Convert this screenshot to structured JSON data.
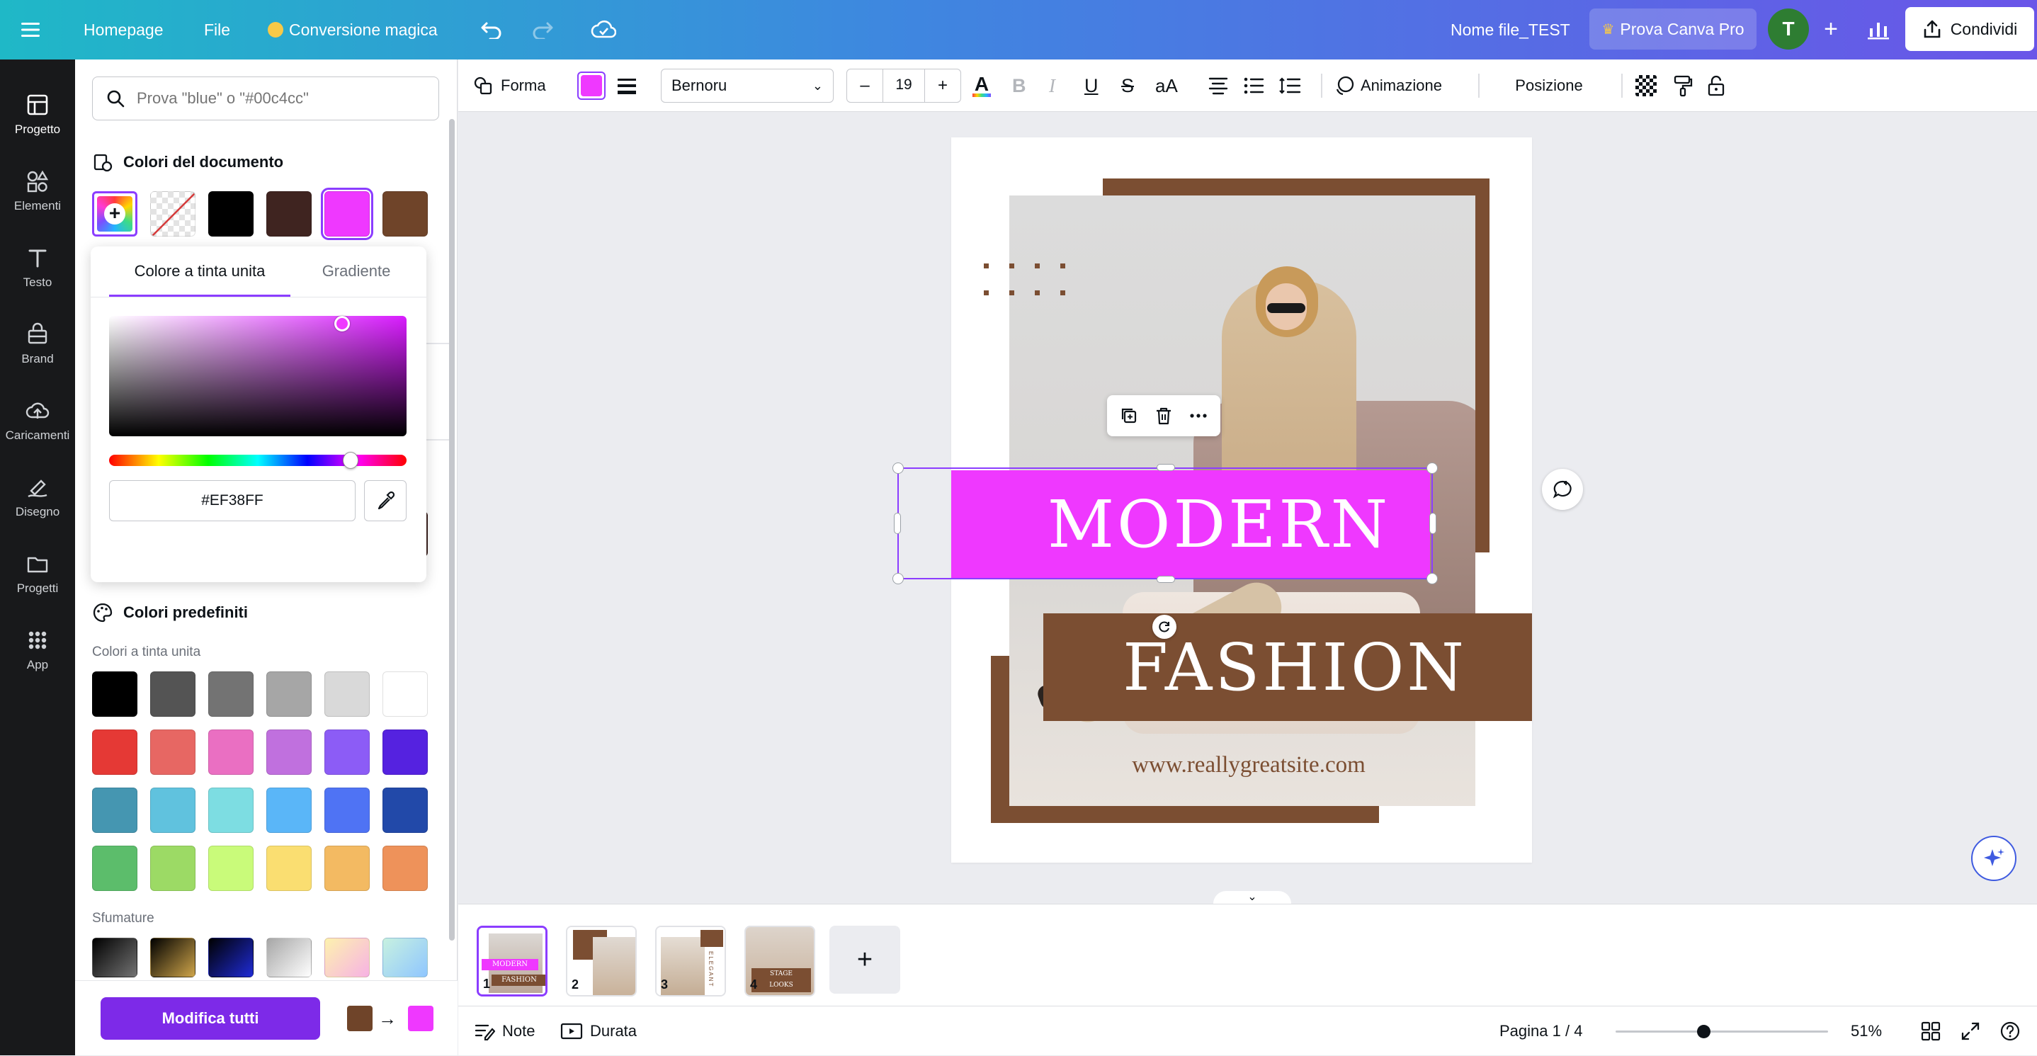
{
  "topbar": {
    "homepage": "Homepage",
    "file": "File",
    "magic": "Conversione magica",
    "filename": "Nome file_TEST",
    "try_pro": "Prova Canva Pro",
    "avatar_letter": "T",
    "share": "Condividi"
  },
  "rail": [
    {
      "label": "Progetto",
      "icon": "layout-icon"
    },
    {
      "label": "Elementi",
      "icon": "elements-icon"
    },
    {
      "label": "Testo",
      "icon": "text-icon"
    },
    {
      "label": "Brand",
      "icon": "brand-icon"
    },
    {
      "label": "Caricamenti",
      "icon": "upload-icon"
    },
    {
      "label": "Disegno",
      "icon": "draw-icon"
    },
    {
      "label": "Progetti",
      "icon": "folder-icon"
    },
    {
      "label": "App",
      "icon": "apps-icon"
    }
  ],
  "panel": {
    "search_placeholder": "Prova \"blue\" o \"#00c4cc\"",
    "doc_colors_title": "Colori del documento",
    "doc_colors": [
      "#000000",
      "#3f2420",
      "#ef38ff",
      "#6f4429"
    ],
    "picker": {
      "tab_solid": "Colore a tinta unita",
      "tab_gradient": "Gradiente",
      "hex": "#EF38FF"
    },
    "photo_colors": [
      "#a9a8a7",
      "#bfa594",
      "#8c7566",
      "#e8e6e6",
      "#3f2420"
    ],
    "preset_title": "Colori predefiniti",
    "solid_title": "Colori a tinta unita",
    "solid_colors": [
      "#000000",
      "#545454",
      "#737373",
      "#a6a6a6",
      "#d9d9d9",
      "#ffffff",
      "#e53935",
      "#e76763",
      "#ea6fc2",
      "#c070de",
      "#8c5cf6",
      "#5522e0",
      "#4596b1",
      "#60c2de",
      "#7ddde2",
      "#5ab6f8",
      "#4f73f4",
      "#2249a9",
      "#5cbd6b",
      "#9cda65",
      "#c9fb7a",
      "#fade71",
      "#f3ba62",
      "#ee925a"
    ],
    "gradient_title": "Sfumature",
    "modify_all": "Modifica tutti",
    "modify_from": "#6f4429",
    "modify_to": "#ef38ff"
  },
  "toolbar": {
    "shape": "Forma",
    "current_color": "#ef38ff",
    "font": "Bernoru",
    "font_size": "19",
    "minus": "–",
    "plus": "+",
    "animation": "Animazione",
    "position": "Posizione"
  },
  "design": {
    "title1": "MODERN",
    "title2": "FASHION",
    "website": "www.reallygreatsite.com",
    "brown": "#7b4e32",
    "magenta": "#ef38ff"
  },
  "pages": {
    "thumb1_top": "MODERN",
    "thumb1_bottom": "FASHION",
    "thumb4_top": "STAGE",
    "thumb4_bottom": "LOOKS",
    "thumb3_side": "ELEGANT",
    "numbers": [
      "1",
      "2",
      "3",
      "4"
    ]
  },
  "footer": {
    "notes": "Note",
    "duration": "Durata",
    "page_indicator": "Pagina 1 / 4",
    "zoom": "51%"
  }
}
